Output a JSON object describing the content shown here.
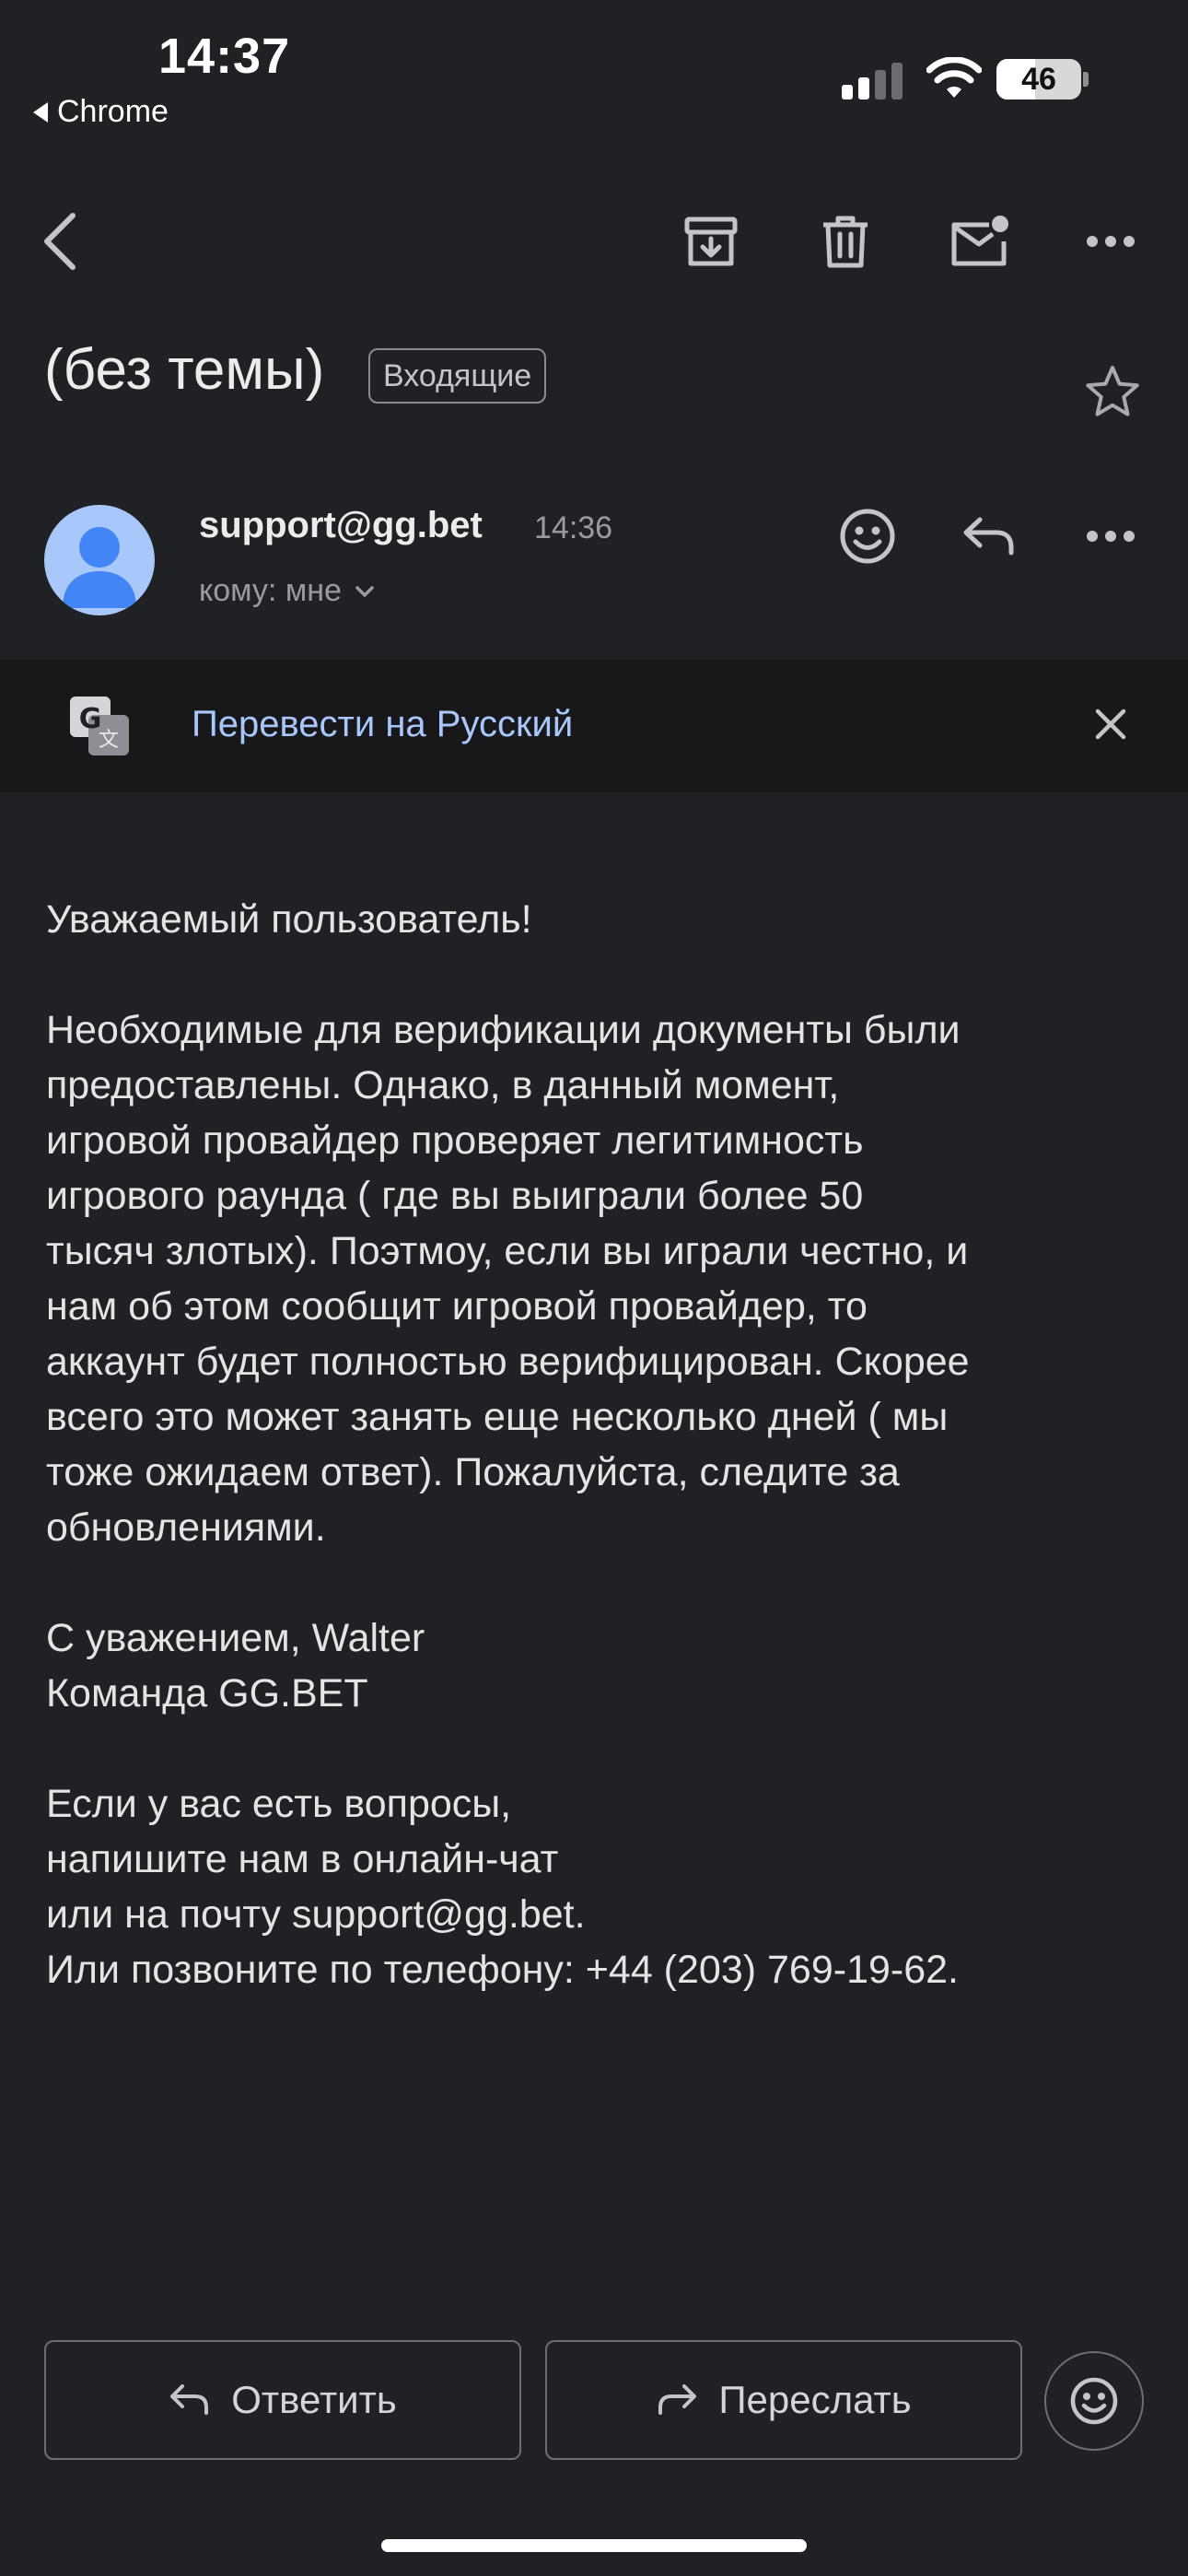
{
  "status_bar": {
    "time": "14:37",
    "back_app": "Chrome",
    "battery": "46",
    "battery_level": 0.46
  },
  "toolbar": {
    "back_icon": "back-arrow-icon",
    "archive_icon": "archive-icon",
    "delete_icon": "trash-icon",
    "mark_unread_icon": "mail-unread-icon",
    "more_icon": "more-horizontal-icon"
  },
  "email": {
    "subject": "(без темы)",
    "label": "Входящие",
    "sender": "support@gg.bet",
    "time": "14:36",
    "recipient": "кому: мне"
  },
  "translate": {
    "link": "Перевести на Русский"
  },
  "body": {
    "greeting": "Уважаемый пользователь!",
    "paragraph_lines": [
      "Необходимые для верификации документы были",
      "предоставлены. Однако, в данный момент,",
      "игровой провайдер проверяет легитимность",
      "игрового раунда ( где вы выиграли более 50",
      "тысяч злотых). Поэтмоу, если вы играли честно, и",
      "нам об этом сообщит игровой провайдер, то",
      "аккаунт будет полностью верифицирован. Скорее",
      "всего это может занять еще несколько дней ( мы",
      "тоже ожидаем ответ). Пожалуйста, следите за",
      "обновлениями."
    ],
    "signature_lines": [
      "С уважением, Walter",
      "Команда GG.BET"
    ],
    "footer_lines": [
      "Если у вас есть вопросы,",
      "напишите нам в онлайн-чат",
      "или на почту support@gg.bet.",
      "Или позвоните по телефону: +44 (203) 769-19-62."
    ]
  },
  "actions": {
    "reply": "Ответить",
    "forward": "Переслать"
  },
  "colors": {
    "background": "#202125",
    "translate_bar": "#18181b",
    "link": "#a8c7fa",
    "avatar": "#a8c7fa",
    "avatar_figure": "#4285f4"
  }
}
